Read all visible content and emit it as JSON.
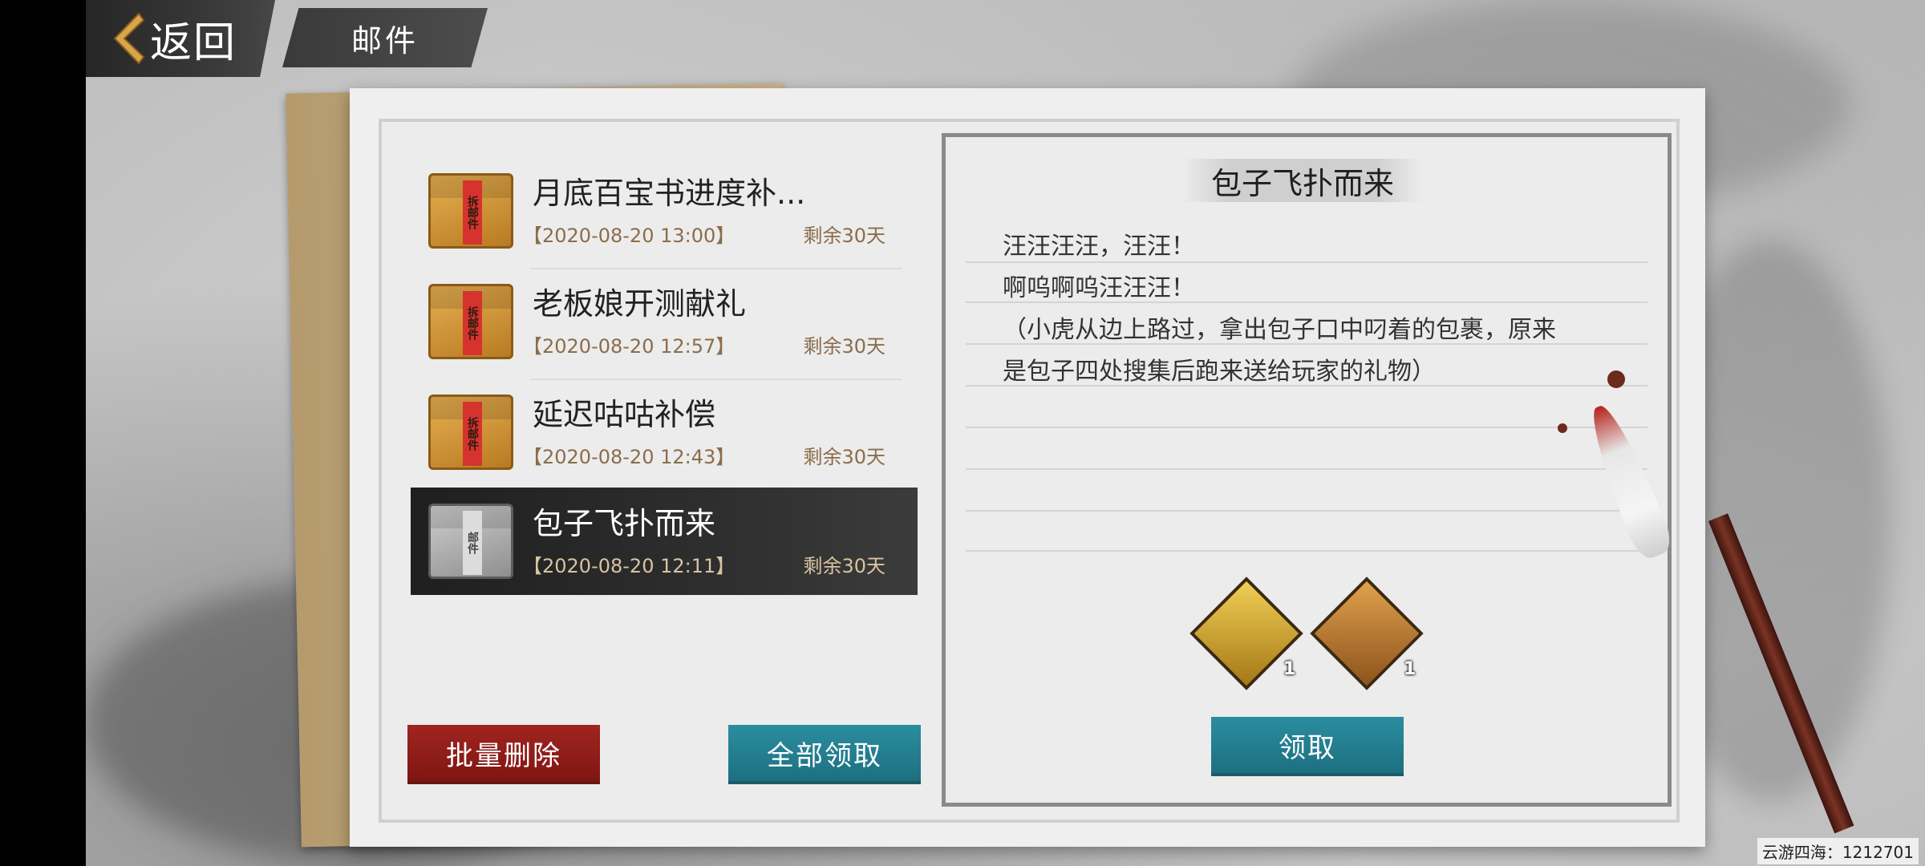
{
  "nav": {
    "back_label": "返回",
    "title": "邮件"
  },
  "mail_list": [
    {
      "title": "月底百宝书进度补...",
      "date": "【2020-08-20 13:00】",
      "remain": "剩余30天",
      "icon": "sealed-envelope-icon",
      "envelope_text": "拆邮件",
      "selected": false
    },
    {
      "title": "老板娘开测献礼",
      "date": "【2020-08-20 12:57】",
      "remain": "剩余30天",
      "icon": "sealed-envelope-icon",
      "envelope_text": "拆邮件",
      "selected": false
    },
    {
      "title": "延迟咕咕补偿",
      "date": "【2020-08-20 12:43】",
      "remain": "剩余30天",
      "icon": "sealed-envelope-icon",
      "envelope_text": "拆邮件",
      "selected": false
    },
    {
      "title": "包子飞扑而来",
      "date": "【2020-08-20 12:11】",
      "remain": "剩余30天",
      "icon": "opened-envelope-icon",
      "envelope_text": "邮件",
      "selected": true
    }
  ],
  "list_actions": {
    "batch_delete": "批量删除",
    "claim_all": "全部领取"
  },
  "detail": {
    "title": "包子飞扑而来",
    "body": [
      "汪汪汪汪，汪汪！",
      "啊呜啊呜汪汪汪！",
      "（小虎从边上路过，拿出包子口中叼着的包裹，原来",
      "是包子四处搜集后跑来送给玩家的礼物）"
    ],
    "rewards": [
      {
        "icon": "gold-chest-icon",
        "count": "1"
      },
      {
        "icon": "bronze-chest-icon",
        "count": "1"
      }
    ],
    "claim_label": "领取"
  },
  "footer": {
    "server_id": "云游四海：1212701"
  },
  "colors": {
    "red_button": "#8f1d1a",
    "teal_button": "#237f90",
    "date_text": "#8b6d4a"
  }
}
